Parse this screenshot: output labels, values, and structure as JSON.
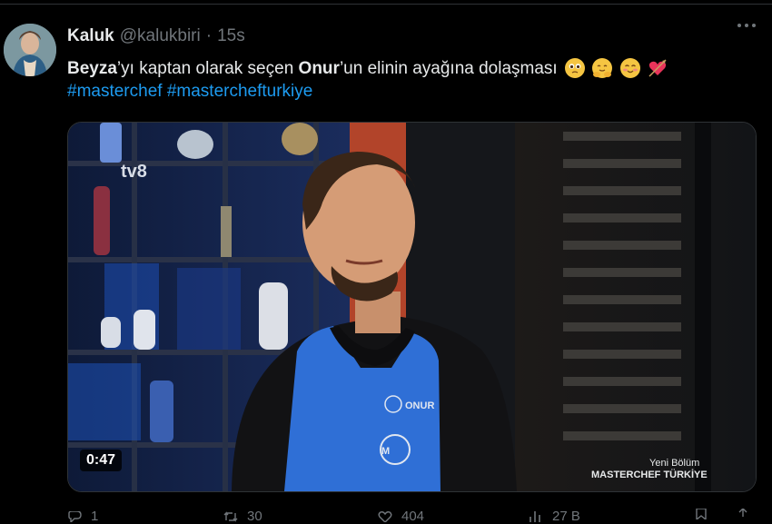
{
  "tweet": {
    "author_name": "Kaluk",
    "author_handle": "@kalukbiri",
    "separator": "·",
    "time": "15s",
    "text_part1": "Beyza",
    "text_part2": "’yı kaptan olarak seçen ",
    "text_part3": "Onur",
    "text_part4": "’un elinin ayağına dolaşması",
    "hashtag1": "#masterchef",
    "hashtag2": "#masterchefturkiye"
  },
  "video": {
    "duration": "0:47",
    "channel_logo": "tv8",
    "apron_name": "ONUR",
    "overlay_line1": "Yeni Bölüm",
    "overlay_line2": "MASTERCHEF TÜRKİYE"
  },
  "actions": {
    "reply_count": "1",
    "retweet_count": "30",
    "like_count": "404",
    "views_count": "27 B"
  },
  "icons": [
    "avatar",
    "more-icon",
    "pleading-emoji",
    "hugging-emoji",
    "blushing-emoji",
    "heart-arrow-emoji",
    "reply-icon",
    "retweet-icon",
    "like-icon",
    "views-icon",
    "bookmark-icon",
    "share-icon"
  ],
  "colors": {
    "accent": "#1d9bf0",
    "muted": "#71767b",
    "text": "#e7e9ea",
    "apron": "#2f6fd6"
  }
}
